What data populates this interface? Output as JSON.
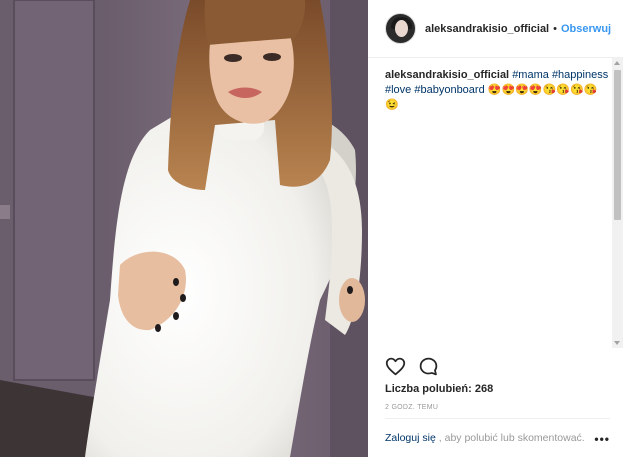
{
  "post": {
    "username": "aleksandrakisio_official",
    "follow_separator": "•",
    "follow_label": "Obserwuj",
    "caption": {
      "username": "aleksandrakisio_official",
      "hashtags": [
        "#mama",
        "#happiness",
        "#love",
        "#babyonboard"
      ],
      "emojis": "😍😍😍😍😘😘😘😘😉"
    },
    "likes_label": "Liczba polubień:",
    "likes_count": "268",
    "timestamp": "2 GODZ. TEMU",
    "footer": {
      "login_link": "Zaloguj się",
      "login_text": ", aby polubić lub skomentować.",
      "more_label": "•••"
    }
  },
  "icons": {
    "like": "heart-icon",
    "comment": "comment-icon",
    "more": "more-options-icon"
  },
  "colors": {
    "link_blue": "#3897f0",
    "hashtag_blue": "#003569",
    "text": "#262626",
    "muted": "#999999"
  }
}
